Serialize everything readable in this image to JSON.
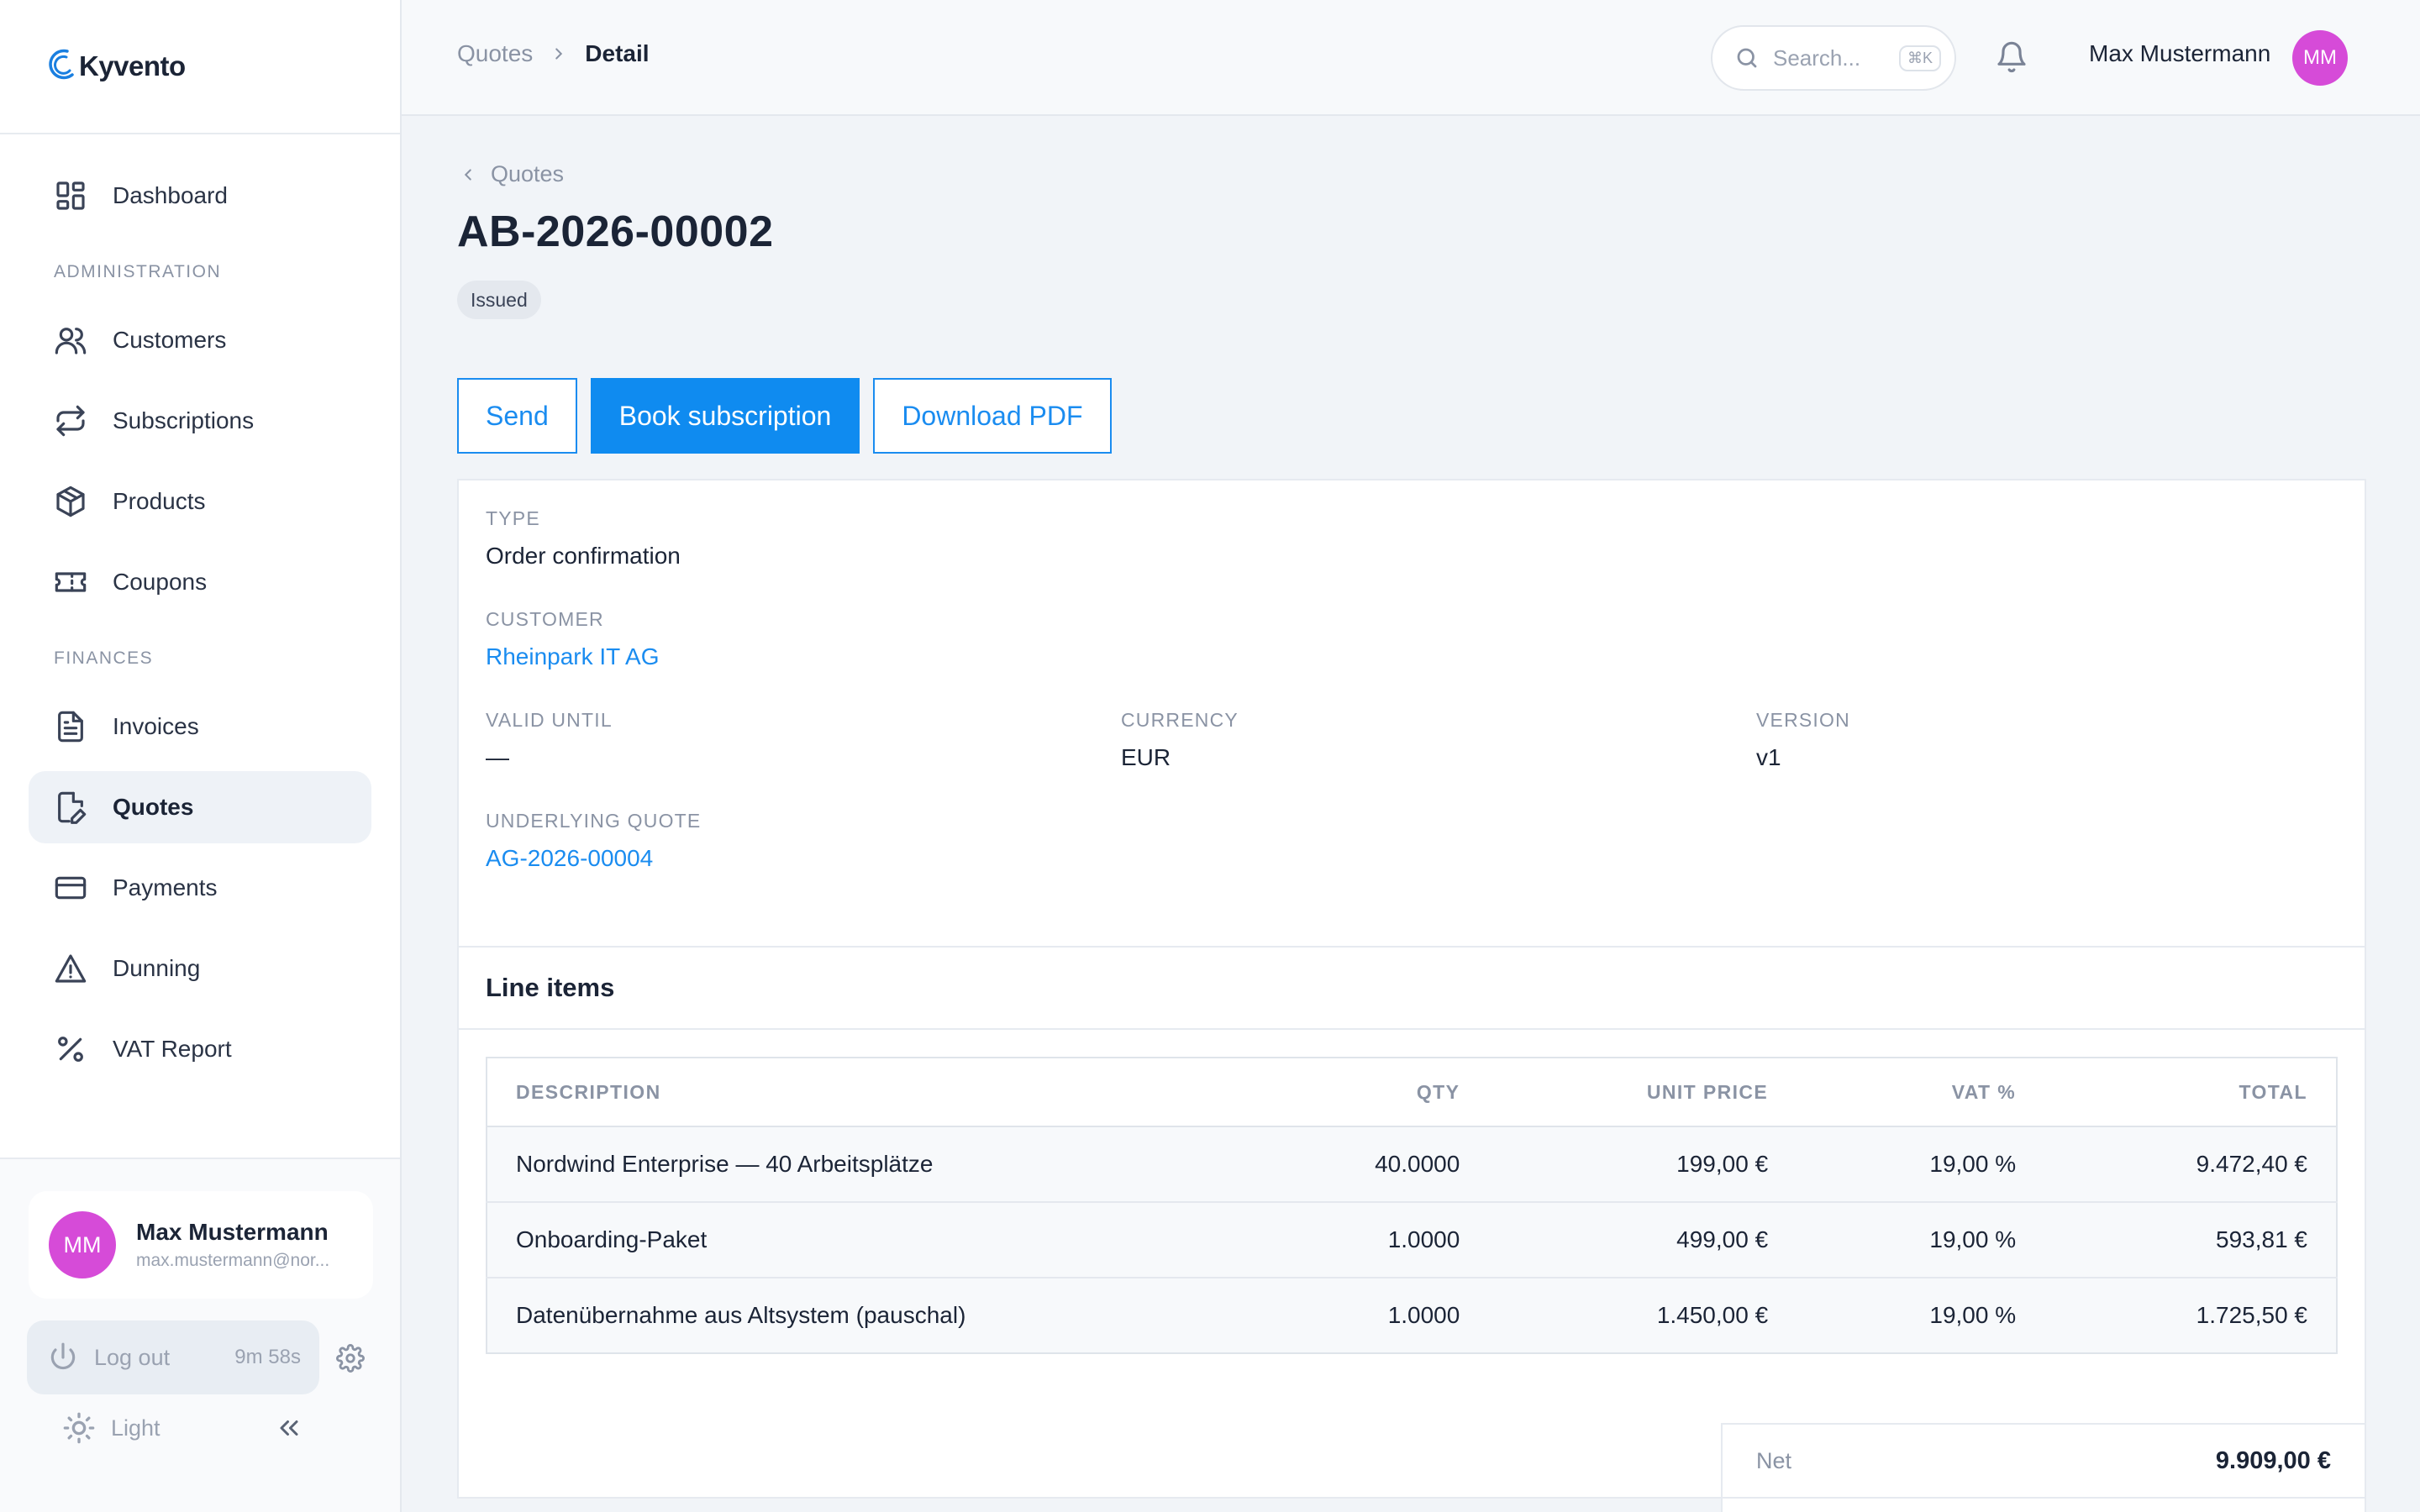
{
  "brand": {
    "name": "Kyvento"
  },
  "sidebar": {
    "dashboard": "Dashboard",
    "admin_section": "ADMINISTRATION",
    "admin_items": [
      "Customers",
      "Subscriptions",
      "Products",
      "Coupons"
    ],
    "finance_section": "FINANCES",
    "finance_items": [
      "Invoices",
      "Quotes",
      "Payments",
      "Dunning",
      "VAT Report"
    ],
    "active": "Quotes",
    "user": {
      "name": "Max Mustermann",
      "email": "max.mustermann@nor...",
      "initials": "MM"
    },
    "logout_label": "Log out",
    "session_timer": "9m 58s",
    "theme_label": "Light"
  },
  "topbar": {
    "breadcrumb": [
      "Quotes",
      "Detail"
    ],
    "search_placeholder": "Search...",
    "search_shortcut": "⌘K",
    "user_name": "Max Mustermann",
    "user_initials": "MM"
  },
  "page": {
    "back_label": "Quotes",
    "title": "AB-2026-00002",
    "status": "Issued",
    "actions": {
      "send": "Send",
      "book": "Book subscription",
      "download": "Download PDF"
    },
    "fields": {
      "type_label": "TYPE",
      "type_value": "Order confirmation",
      "customer_label": "CUSTOMER",
      "customer_value": "Rheinpark IT AG",
      "valid_until_label": "VALID UNTIL",
      "valid_until_value": "—",
      "currency_label": "CURRENCY",
      "currency_value": "EUR",
      "version_label": "VERSION",
      "version_value": "v1",
      "underlying_label": "UNDERLYING QUOTE",
      "underlying_value": "AG-2026-00004"
    },
    "line_items": {
      "title": "Line items",
      "columns": [
        "DESCRIPTION",
        "QTY",
        "UNIT PRICE",
        "VAT %",
        "TOTAL"
      ],
      "rows": [
        [
          "Nordwind Enterprise — 40 Arbeitsplätze",
          "40.0000",
          "199,00 €",
          "19,00 %",
          "9.472,40 €"
        ],
        [
          "Onboarding-Paket",
          "1.0000",
          "499,00 €",
          "19,00 %",
          "593,81 €"
        ],
        [
          "Datenübernahme aus Altsystem (pauschal)",
          "1.0000",
          "1.450,00 €",
          "19,00 %",
          "1.725,50 €"
        ]
      ]
    },
    "totals": {
      "net_label": "Net",
      "net_value": "9.909,00 €"
    }
  },
  "colors": {
    "accent": "#0f8bf0",
    "avatar": "#d64bd8",
    "active_nav_bg": "#eef2f7"
  }
}
